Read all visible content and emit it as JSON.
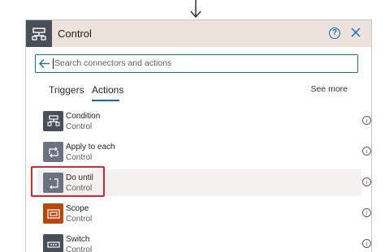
{
  "header": {
    "title": "Control",
    "help_label": "?"
  },
  "search": {
    "placeholder": "Search connectors and actions"
  },
  "tabs": [
    {
      "label": "Triggers"
    },
    {
      "label": "Actions"
    }
  ],
  "see_more": "See more",
  "actions": [
    {
      "name": "Condition",
      "connector": "Control",
      "icon": "condition-icon",
      "color": "#484f58"
    },
    {
      "name": "Apply to each",
      "connector": "Control",
      "icon": "loop-icon",
      "color": "#6b7380"
    },
    {
      "name": "Do until",
      "connector": "Control",
      "icon": "do-until-icon",
      "color": "#6b7380"
    },
    {
      "name": "Scope",
      "connector": "Control",
      "icon": "scope-icon",
      "color": "#b7470b"
    },
    {
      "name": "Switch",
      "connector": "Control",
      "icon": "switch-icon",
      "color": "#484f58"
    }
  ],
  "info_symbol": "i",
  "colors": {
    "accent": "#0f6cbd",
    "header_bg": "#ede2dc",
    "highlight": "#e0252a"
  }
}
